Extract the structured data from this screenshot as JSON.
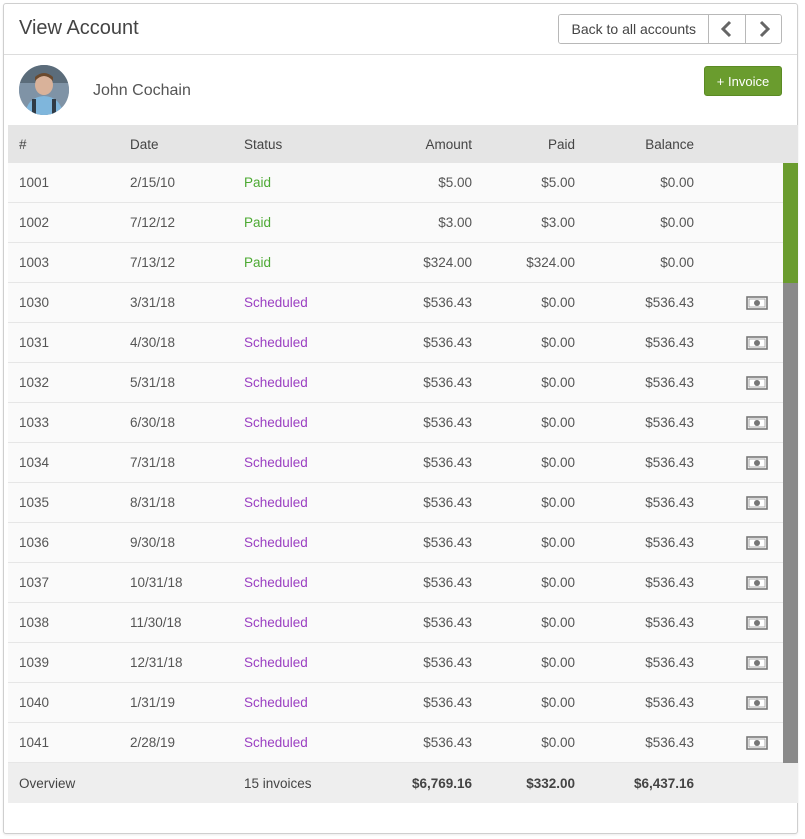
{
  "header": {
    "title": "View Account",
    "back_label": "Back to all accounts"
  },
  "account": {
    "name": "John Cochain",
    "add_invoice_label": "+ Invoice"
  },
  "table": {
    "columns": [
      "#",
      "Date",
      "Status",
      "Amount",
      "Paid",
      "Balance"
    ],
    "rows": [
      {
        "num": "1001",
        "date": "2/15/10",
        "status": "Paid",
        "amount": "$5.00",
        "paid": "$5.00",
        "balance": "$0.00"
      },
      {
        "num": "1002",
        "date": "7/12/12",
        "status": "Paid",
        "amount": "$3.00",
        "paid": "$3.00",
        "balance": "$0.00"
      },
      {
        "num": "1003",
        "date": "7/13/12",
        "status": "Paid",
        "amount": "$324.00",
        "paid": "$324.00",
        "balance": "$0.00"
      },
      {
        "num": "1030",
        "date": "3/31/18",
        "status": "Scheduled",
        "amount": "$536.43",
        "paid": "$0.00",
        "balance": "$536.43"
      },
      {
        "num": "1031",
        "date": "4/30/18",
        "status": "Scheduled",
        "amount": "$536.43",
        "paid": "$0.00",
        "balance": "$536.43"
      },
      {
        "num": "1032",
        "date": "5/31/18",
        "status": "Scheduled",
        "amount": "$536.43",
        "paid": "$0.00",
        "balance": "$536.43"
      },
      {
        "num": "1033",
        "date": "6/30/18",
        "status": "Scheduled",
        "amount": "$536.43",
        "paid": "$0.00",
        "balance": "$536.43"
      },
      {
        "num": "1034",
        "date": "7/31/18",
        "status": "Scheduled",
        "amount": "$536.43",
        "paid": "$0.00",
        "balance": "$536.43"
      },
      {
        "num": "1035",
        "date": "8/31/18",
        "status": "Scheduled",
        "amount": "$536.43",
        "paid": "$0.00",
        "balance": "$536.43"
      },
      {
        "num": "1036",
        "date": "9/30/18",
        "status": "Scheduled",
        "amount": "$536.43",
        "paid": "$0.00",
        "balance": "$536.43"
      },
      {
        "num": "1037",
        "date": "10/31/18",
        "status": "Scheduled",
        "amount": "$536.43",
        "paid": "$0.00",
        "balance": "$536.43"
      },
      {
        "num": "1038",
        "date": "11/30/18",
        "status": "Scheduled",
        "amount": "$536.43",
        "paid": "$0.00",
        "balance": "$536.43"
      },
      {
        "num": "1039",
        "date": "12/31/18",
        "status": "Scheduled",
        "amount": "$536.43",
        "paid": "$0.00",
        "balance": "$536.43"
      },
      {
        "num": "1040",
        "date": "1/31/19",
        "status": "Scheduled",
        "amount": "$536.43",
        "paid": "$0.00",
        "balance": "$536.43"
      },
      {
        "num": "1041",
        "date": "2/28/19",
        "status": "Scheduled",
        "amount": "$536.43",
        "paid": "$0.00",
        "balance": "$536.43"
      }
    ],
    "overview": {
      "label": "Overview",
      "count": "15 invoices",
      "amount": "$6,769.16",
      "paid": "$332.00",
      "balance": "$6,437.16"
    }
  },
  "icons": {
    "prev": "chevron-left-icon",
    "next": "chevron-right-icon",
    "pay": "money-bill-icon"
  },
  "colors": {
    "paid_text": "#4ca932",
    "scheduled_text": "#9b3fc2",
    "paid_bar": "#6a9c2e",
    "scheduled_bar": "#8a8a8a",
    "invoice_button": "#6a9c2e"
  }
}
